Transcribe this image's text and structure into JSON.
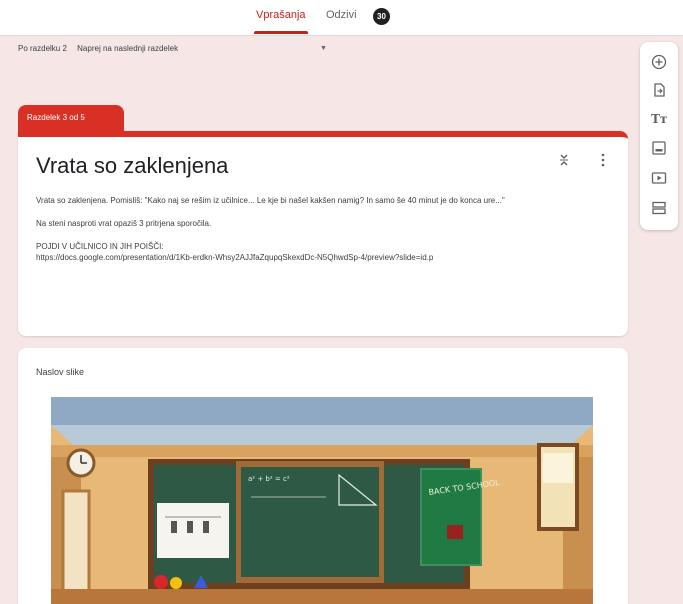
{
  "tabs": {
    "questions": "Vprašanja",
    "responses": "Odzivi",
    "responses_count": "30"
  },
  "after_section": {
    "label": "Po razdelku 2",
    "value": "Naprej na naslednji razdelek"
  },
  "section": {
    "tab_label": "Razdelek 3 od 5",
    "title": "Vrata so zaklenjena",
    "description": [
      "Vrata so zaklenjena. Pomisliš: \"Kako naj se rešim iz učilnice... Le kje bi našel kakšen namig? In samo še 40 minut je do konca ure...\"",
      "Na steni nasproti vrat opaziš 3 pritrjena sporočila.",
      "POJDI V UČILNICO IN JIH POIŠČI:\nhttps://docs.google.com/presentation/d/1Kb-erdkn-Whsy2AJJfaZqupqSkexdDc-N5QhwdSp-4/preview?slide=id.p"
    ]
  },
  "image_item": {
    "title": "Naslov slike",
    "chalkboard_text": "BACK TO SCHOOL",
    "formula": "a² + b² = c²"
  },
  "toolbar": {
    "icons": [
      "add-question-icon",
      "import-questions-icon",
      "add-title-icon",
      "add-image-icon",
      "add-video-icon",
      "add-section-icon"
    ],
    "title_glyph": "Tт"
  },
  "colors": {
    "accent": "#d93025",
    "background": "#f7e6e6",
    "board": "#2e5a45"
  }
}
